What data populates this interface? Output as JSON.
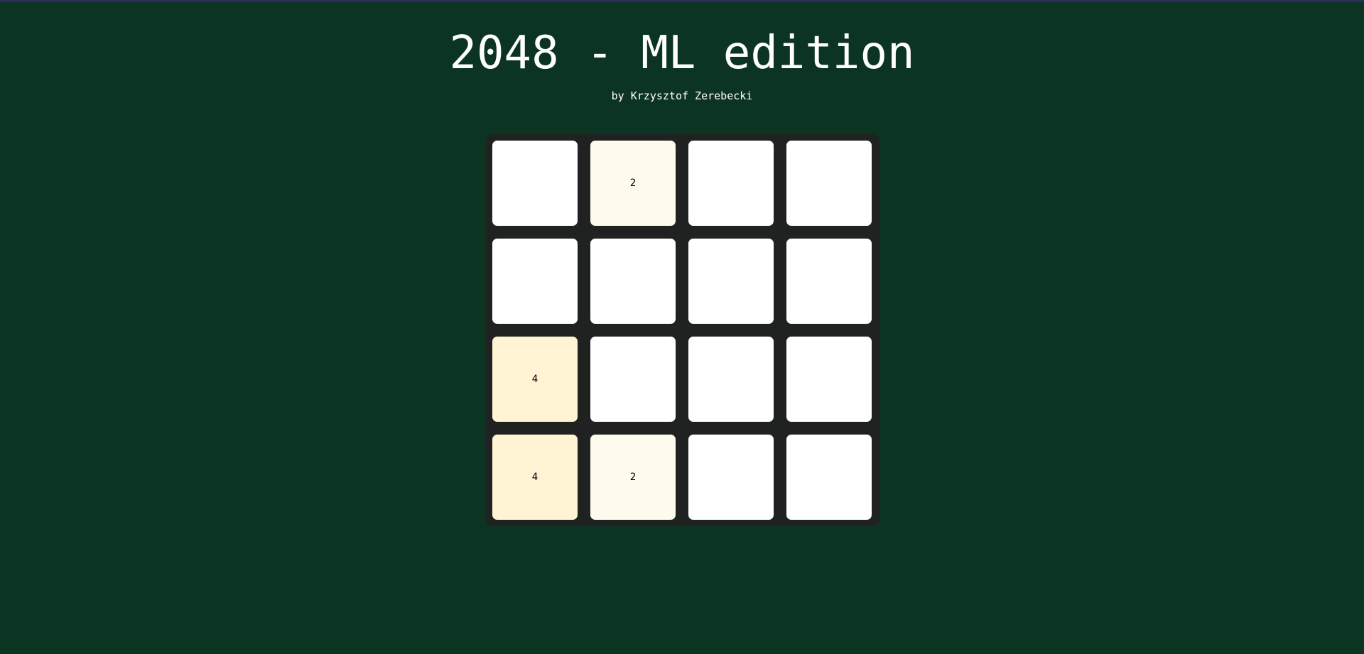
{
  "header": {
    "title": "2048 - ML edition",
    "subtitle": "by Krzysztof Zerebecki"
  },
  "colors": {
    "background": "#0c3422",
    "board": "#1f2221",
    "empty_tile": "#ffffff",
    "tile_2": "#fffaee",
    "tile_4": "#fff3d4"
  },
  "board": {
    "rows": [
      [
        "",
        "2",
        "",
        ""
      ],
      [
        "",
        "",
        "",
        ""
      ],
      [
        "4",
        "",
        "",
        ""
      ],
      [
        "4",
        "2",
        "",
        ""
      ]
    ]
  }
}
